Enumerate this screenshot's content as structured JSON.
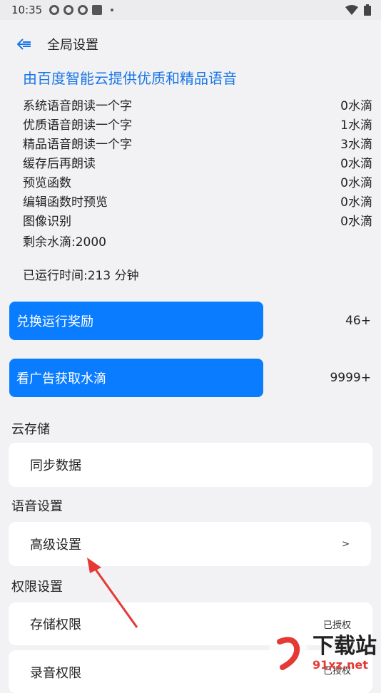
{
  "status_bar": {
    "time": "10:35"
  },
  "header": {
    "title": "全局设置"
  },
  "banner": "由百度智能云提供优质和精品语音",
  "costs": [
    {
      "label": "系统语音朗读一个字",
      "value": "0水滴"
    },
    {
      "label": "优质语音朗读一个字",
      "value": "1水滴"
    },
    {
      "label": "精品语音朗读一个字",
      "value": "3水滴"
    },
    {
      "label": "缓存后再朗读",
      "value": "0水滴"
    },
    {
      "label": "预览函数",
      "value": "0水滴"
    },
    {
      "label": "编辑函数时预览",
      "value": "0水滴"
    },
    {
      "label": "图像识别",
      "value": "0水滴"
    }
  ],
  "remaining": "剩余水滴:2000",
  "runtime": "已运行时间:213 分钟",
  "actions": {
    "exchange": {
      "label": "兑换运行奖励",
      "count": "46+"
    },
    "watch_ad": {
      "label": "看广告获取水滴",
      "count": "9999+"
    }
  },
  "cloud": {
    "title": "云存储",
    "sync": "同步数据"
  },
  "voice": {
    "title": "语音设置",
    "advanced": "高级设置",
    "advanced_trail": ">"
  },
  "perm": {
    "title": "权限设置",
    "storage": "存储权限",
    "storage_status": "已授权",
    "record": "录音权限",
    "record_status": "已授权"
  },
  "watermark": {
    "text": "下载站",
    "sub": "91xz.net"
  },
  "colors": {
    "accent": "#0a7cff",
    "banner": "#1976e6",
    "arrow": "#e53935"
  }
}
